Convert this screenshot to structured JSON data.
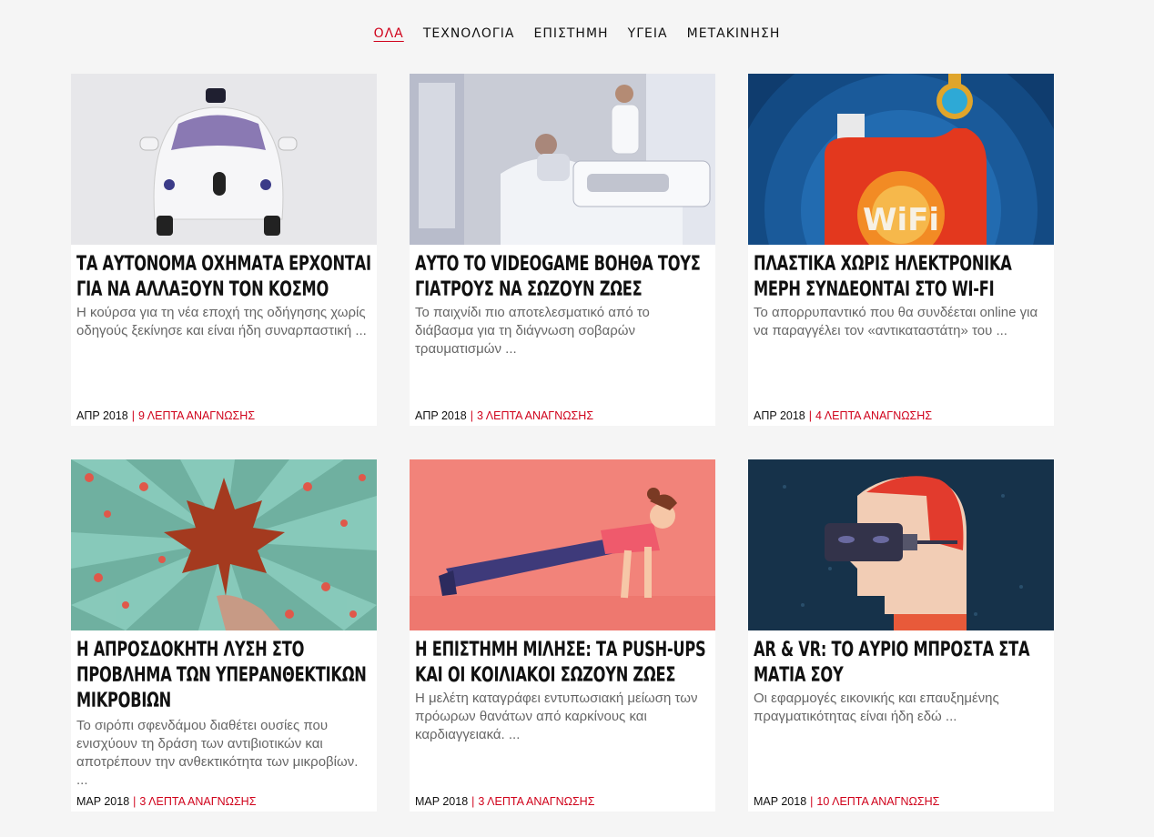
{
  "nav": {
    "items": [
      "ΟΛΑ",
      "ΤΕΧΝΟΛΟΓΙΑ",
      "ΕΠΙΣΤΗΜΗ",
      "ΥΓΕΙΑ",
      "ΜΕΤΑΚΙΝΗΣΗ"
    ],
    "active": "ΟΛΑ"
  },
  "colors": {
    "accent": "#d0021b",
    "background": "#f5f5f5"
  },
  "articles": [
    {
      "title": "ΤΑ ΑΥΤΟΝΟΜΑ ΟΧΗΜΑΤΑ ΕΡΧΟΝΤΑΙ ΓΙΑ ΝΑ ΑΛΛΑΞΟΥΝ ΤΟΝ ΚΟΣΜΟ",
      "excerpt": "Η κούρσα για τη νέα εποχή της οδήγησης χωρίς οδηγούς ξεκίνησε και είναι ήδη συναρπαστική ...",
      "date": "ΑΠΡ 2018",
      "read_time": "9 ΛΕΠΤΑ ΑΝΑΓΝΩΣΗΣ",
      "image": "self-driving-car-image"
    },
    {
      "title": "ΑΥΤΟ ΤΟ VIDEOGAME ΒΟΗΘΑ ΤΟΥΣ ΓΙΑΤΡΟΥΣ ΝΑ ΣΩΖΟΥΝ ΖΩΕΣ",
      "excerpt": "Το παιχνίδι πιο αποτελεσματικό από το διάβασμα για τη διάγνωση σοβαρών τραυματισμών ...",
      "date": "ΑΠΡ 2018",
      "read_time": "3 ΛΕΠΤΑ ΑΝΑΓΝΩΣΗΣ",
      "image": "hospital-room-image"
    },
    {
      "title": "ΠΛΑΣΤΙΚΑ ΧΩΡΙΣ ΗΛΕΚΤΡΟΝΙΚΑ ΜΕΡΗ ΣΥΝΔΕΟΝΤΑΙ ΣΤΟ WI-FI",
      "excerpt": "Το απορρυπαντικό που θα συνδέεται online για να παραγγέλει τον «αντικαταστάτη» του ...",
      "date": "ΑΠΡ 2018",
      "read_time": "4 ΛΕΠΤΑ ΑΝΑΓΝΩΣΗΣ",
      "image": "wifi-detergent-image"
    },
    {
      "title": "Η ΑΠΡΟΣΔΟΚΗΤΗ ΛΥΣΗ ΣΤΟ ΠΡΟΒΛΗΜΑ ΤΩΝ ΥΠΕΡΑΝΘΕΚΤΙΚΩΝ ΜΙΚΡΟΒΙΩΝ",
      "excerpt": "Το σιρόπι σφενδάμου διαθέτει ουσίες που ενισχύουν τη δράση των αντιβιοτικών και αποτρέπουν την ανθεκτικότητα των μικροβίων. ...",
      "date": "ΜΑΡ 2018",
      "read_time": "3 ΛΕΠΤΑ ΑΝΑΓΝΩΣΗΣ",
      "image": "maple-leaf-image"
    },
    {
      "title": "Η ΕΠΙΣΤΗΜΗ ΜΙΛΗΣΕ: ΤΑ PUSH-UPS ΚΑΙ ΟΙ ΚΟΙΛΙΑΚΟΙ ΣΩΖΟΥΝ ΖΩΕΣ",
      "excerpt": "Η μελέτη καταγράφει εντυπωσιακή μείωση των πρόωρων θανάτων από καρκίνους και καρδιαγγειακά. ...",
      "date": "ΜΑΡ 2018",
      "read_time": "3 ΛΕΠΤΑ ΑΝΑΓΝΩΣΗΣ",
      "image": "push-ups-image"
    },
    {
      "title": "AR & VR: ΤΟ ΑΥΡΙΟ ΜΠΡΟΣΤΑ ΣΤΑ ΜΑΤΙΑ ΣΟΥ",
      "excerpt": "Οι εφαρμογές εικονικής και επαυξημένης πραγματικότητας είναι ήδη εδώ ...",
      "date": "ΜΑΡ 2018",
      "read_time": "10 ΛΕΠΤΑ ΑΝΑΓΝΩΣΗΣ",
      "image": "vr-headset-image"
    }
  ]
}
